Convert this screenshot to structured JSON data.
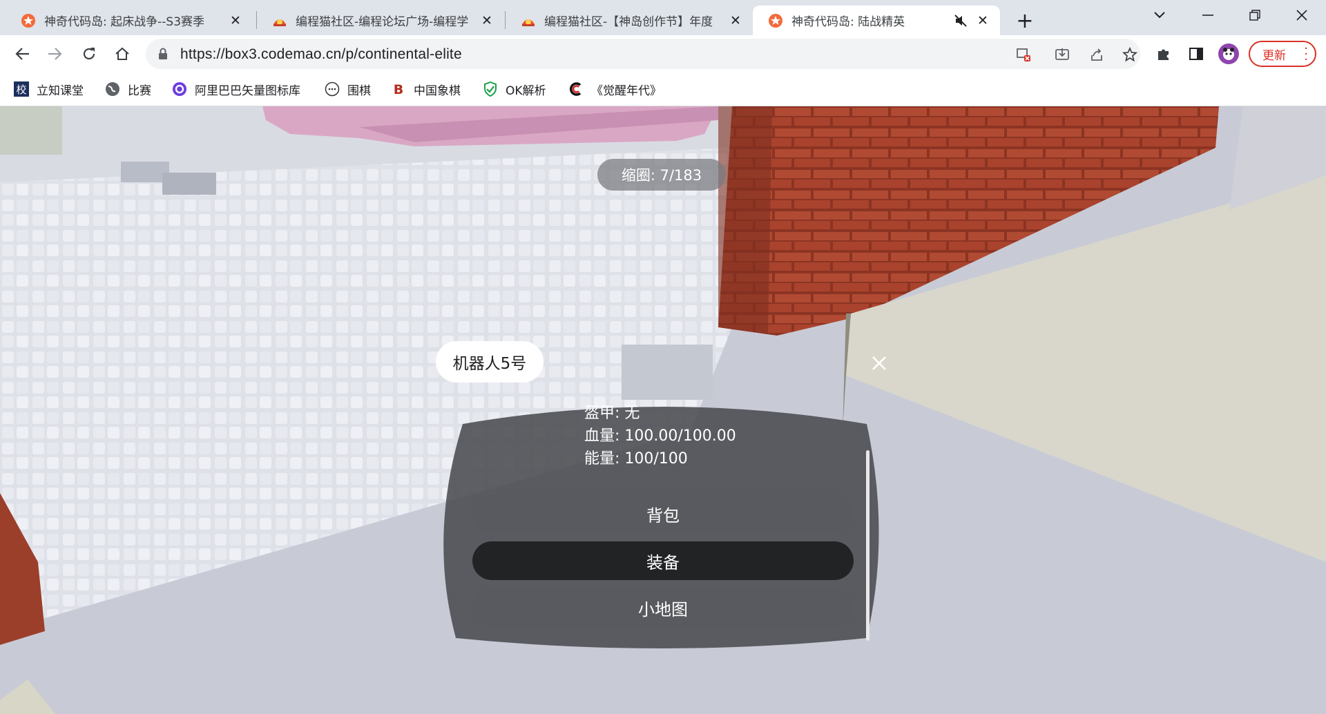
{
  "browser": {
    "tabs": [
      {
        "title": "神奇代码岛: 起床战争--S3赛季",
        "active": false
      },
      {
        "title": "编程猫社区-编程论坛广场-编程学",
        "active": false
      },
      {
        "title": "编程猫社区-【神岛创作节】年度",
        "active": false
      },
      {
        "title": "神奇代码岛: 陆战精英",
        "active": true
      }
    ],
    "new_tab_label": "+",
    "url": "https://box3.codemao.cn/p/continental-elite",
    "update_label": "更新",
    "bookmarks": [
      {
        "label": "立知课堂",
        "icon": "school-icon"
      },
      {
        "label": "比赛",
        "icon": "globe-icon"
      },
      {
        "label": "阿里巴巴矢量图标库",
        "icon": "iconfont-icon"
      },
      {
        "label": "围棋",
        "icon": "go-game-icon"
      },
      {
        "label": "中国象棋",
        "icon": "chess-icon"
      },
      {
        "label": "OK解析",
        "icon": "shield-check-icon"
      },
      {
        "label": "《觉醒年代》",
        "icon": "c-logo-icon"
      }
    ],
    "colors": {
      "tabbar": "#dfe3ea",
      "update": "#d93025",
      "favicon": "#e8532b"
    }
  },
  "game": {
    "ring_text": "缩圈: 7/183",
    "player_name": "机器人5号",
    "stats": {
      "armor": "盔甲: 无",
      "health": "血量: 100.00/100.00",
      "energy": "能量: 100/100"
    },
    "menu": [
      {
        "label": "背包",
        "selected": false
      },
      {
        "label": "装备",
        "selected": true
      },
      {
        "label": "小地图",
        "selected": false
      }
    ],
    "colors": {
      "panel": "#4a4b50",
      "button": "#595a5f",
      "button_selected": "#222325"
    }
  }
}
